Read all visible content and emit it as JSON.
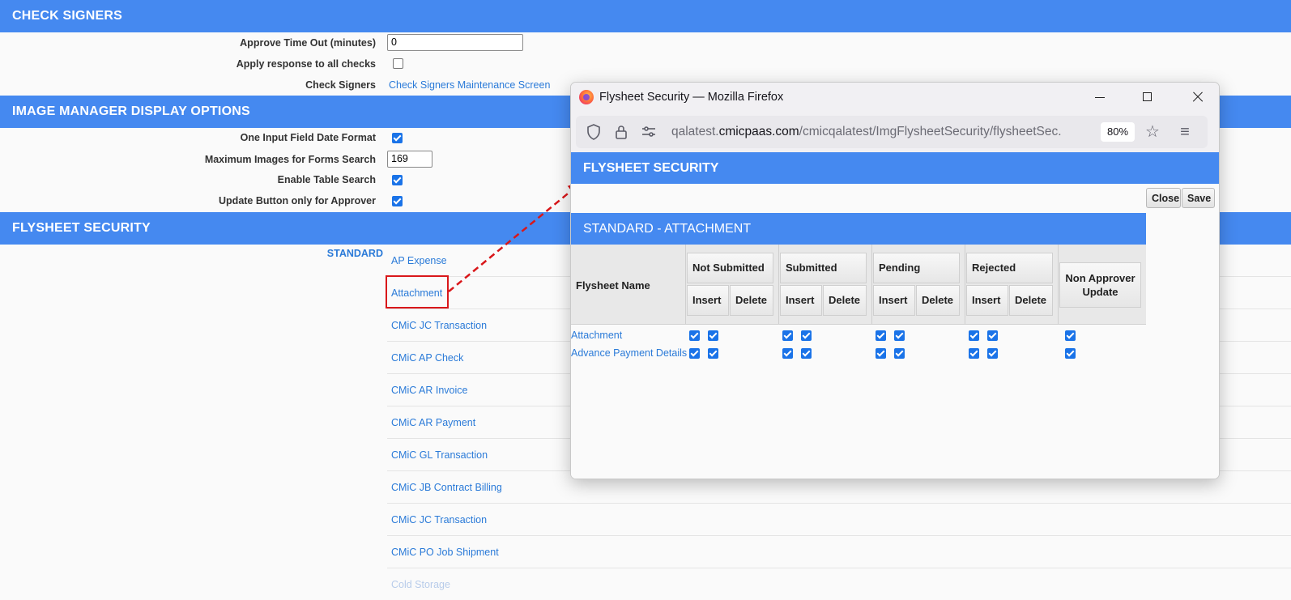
{
  "check_signers": {
    "title": "CHECK SIGNERS",
    "approve_timeout_label": "Approve Time Out (minutes)",
    "approve_timeout_value": "0",
    "apply_response_label": "Apply response to all checks",
    "check_signers_label": "Check Signers",
    "check_signers_link": "Check Signers Maintenance Screen"
  },
  "image_manager": {
    "title": "IMAGE MANAGER DISPLAY OPTIONS",
    "date_format_label": "One Input Field Date Format",
    "max_images_label": "Maximum Images for Forms Search",
    "max_images_value": "169",
    "table_search_label": "Enable Table Search",
    "update_button_label": "Update Button only for Approver"
  },
  "flysheet": {
    "title": "FLYSHEET SECURITY",
    "group_label": "STANDARD",
    "items": [
      "AP Expense",
      "Attachment",
      "CMiC JC Transaction",
      "CMiC AP Check",
      "CMiC AR Invoice",
      "CMiC AR Payment",
      "CMiC GL Transaction",
      "CMiC JB Contract Billing",
      "CMiC JC Transaction",
      "CMiC PO Job Shipment",
      "Cold Storage"
    ]
  },
  "popup": {
    "window_title": "Flysheet Security — Mozilla Firefox",
    "url_prefix": "qalatest.",
    "url_domain": "cmicpaas.com",
    "url_path": "/cmicqalatest/ImgFlysheetSecurity/flysheetSec.",
    "zoom": "80%",
    "header": "FLYSHEET SECURITY",
    "close_label": "Close",
    "save_label": "Save",
    "subheader": "STANDARD - ATTACHMENT",
    "col_name": "Flysheet Name",
    "groups": [
      "Not Submitted",
      "Submitted",
      "Pending",
      "Rejected"
    ],
    "insert_label": "Insert",
    "delete_label": "Delete",
    "non_approver_label": "Non Approver Update",
    "rows": [
      "Attachment",
      "Advance Payment Details"
    ]
  },
  "colors": {
    "accent": "#4589f0",
    "link": "#2a7ad8",
    "highlight": "#d9171a"
  }
}
